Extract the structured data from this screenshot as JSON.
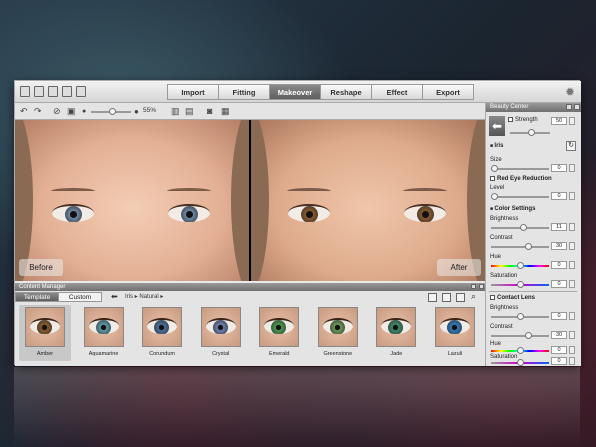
{
  "tabs": [
    "Import",
    "Fitting",
    "Makeover",
    "Reshape",
    "Effect",
    "Export"
  ],
  "active_tab": "Makeover",
  "zoom": "55%",
  "photo_labels": {
    "before": "Before",
    "after": "After"
  },
  "beauty_center": {
    "title": "Beauty Center",
    "strength_label": "Strength",
    "strength_value": "50",
    "iris_title": "Iris",
    "size_label": "Size",
    "size_value": "0",
    "red_eye_label": "Red Eye Reduction",
    "level_label": "Level",
    "level_value": "0",
    "color_settings_title": "Color Settings",
    "brightness_label": "Brightness",
    "brightness_value": "11",
    "contrast_label": "Contrast",
    "contrast_value": "30",
    "hue_label": "Hue",
    "hue_value": "0",
    "saturation_label": "Saturation",
    "saturation_value": "0",
    "contact_lens_title": "Contact Lens",
    "lens_brightness_label": "Brightness",
    "lens_brightness_value": "0",
    "lens_contrast_label": "Contrast",
    "lens_contrast_value": "30",
    "lens_hue_label": "Hue",
    "lens_hue_value": "0",
    "lens_saturation_label": "Saturation",
    "lens_saturation_value": "0"
  },
  "content_manager": {
    "title": "Content Manager",
    "tabs": [
      "Template",
      "Custom"
    ],
    "active_tab": "Template",
    "breadcrumb": [
      "Iris",
      "Natural"
    ],
    "thumbnails": [
      {
        "label": "Amber",
        "color": "#8a5a2a"
      },
      {
        "label": "Aquamarine",
        "color": "#5e9aa8"
      },
      {
        "label": "Corundum",
        "color": "#4f6f9e"
      },
      {
        "label": "Crystal",
        "color": "#6f7fae"
      },
      {
        "label": "Emerald",
        "color": "#4a9a4e"
      },
      {
        "label": "Greenstone",
        "color": "#6a9a5a"
      },
      {
        "label": "Jade",
        "color": "#3f8a6a"
      },
      {
        "label": "Lazuli",
        "color": "#2f7aba"
      }
    ],
    "selected": "Amber"
  },
  "colors": {
    "before_iris": "#6f8aa8",
    "after_iris": "#8a5a2e"
  }
}
